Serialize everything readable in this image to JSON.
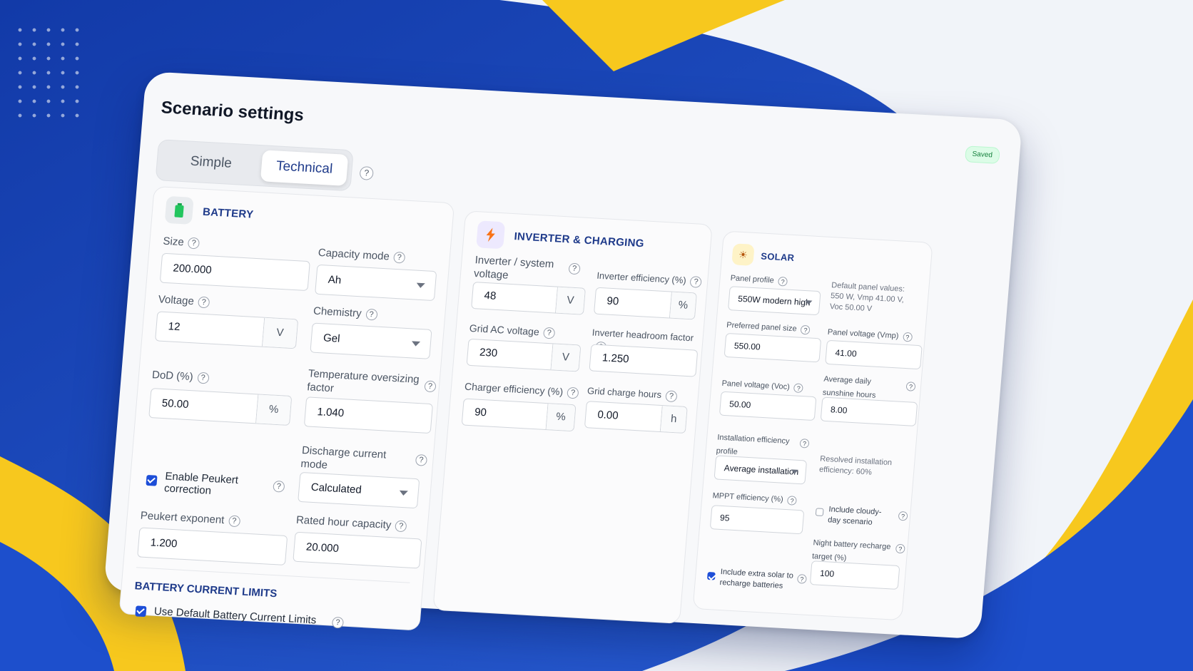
{
  "title": "Scenario settings",
  "mode_tabs": [
    "Simple",
    "Technical"
  ],
  "status_badge": "Saved",
  "battery": {
    "header": "BATTERY",
    "size_label": "Size",
    "size_value": "200.000",
    "capacity_mode_label": "Capacity mode",
    "capacity_mode_value": "Ah",
    "voltage_label": "Voltage",
    "voltage_value": "12",
    "voltage_unit": "V",
    "chemistry_label": "Chemistry",
    "chemistry_value": "Gel",
    "dod_label": "DoD (%)",
    "dod_value": "50.00",
    "dod_unit": "%",
    "temp_label": "Temperature oversizing factor",
    "temp_value": "1.040",
    "discharge_label": "Discharge current mode",
    "discharge_value": "Calculated",
    "peukert_check_label": "Enable Peukert correction",
    "peukert_exp_label": "Peukert exponent",
    "peukert_exp_value": "1.200",
    "rated_hour_label": "Rated hour capacity",
    "rated_hour_value": "20.000",
    "limits_header": "BATTERY CURRENT LIMITS",
    "limits_check_label": "Use Default Battery Current Limits"
  },
  "inverter": {
    "header": "INVERTER & CHARGING",
    "sys_voltage_label": "Inverter / system voltage",
    "sys_voltage_value": "48",
    "sys_voltage_unit": "V",
    "inv_eff_label": "Inverter efficiency (%)",
    "inv_eff_value": "90",
    "inv_eff_unit": "%",
    "grid_ac_label": "Grid AC voltage",
    "grid_ac_value": "230",
    "grid_ac_unit": "V",
    "headroom_label": "Inverter headroom factor",
    "headroom_value": "1.250",
    "charger_eff_label": "Charger efficiency (%)",
    "charger_eff_value": "90",
    "charger_eff_unit": "%",
    "grid_hours_label": "Grid charge hours",
    "grid_hours_value": "0.00",
    "grid_hours_unit": "h"
  },
  "solar": {
    "header": "SOLAR",
    "panel_profile_label": "Panel profile",
    "panel_profile_value": "550W modern high",
    "panel_defaults_note": "Default panel values: 550 W, Vmp 41.00 V, Voc 50.00 V",
    "panel_size_label": "Preferred panel size",
    "panel_size_value": "550.00",
    "vmp_label": "Panel voltage (Vmp)",
    "vmp_value": "41.00",
    "voc_label": "Panel voltage (Voc)",
    "voc_value": "50.00",
    "sunshine_label": "Average daily sunshine hours",
    "sunshine_value": "8.00",
    "install_label": "Installation efficiency profile",
    "install_value": "Average installation",
    "resolved_note": "Resolved installation efficiency: 60%",
    "mppt_label": "MPPT efficiency (%)",
    "mppt_value": "95",
    "cloudy_label": "Include cloudy-day scenario",
    "night_label": "Night battery recharge target (%)",
    "night_value": "100",
    "extra_solar_label": "Include extra solar to recharge batteries"
  },
  "colors": {
    "accent": "#1e3a8a",
    "brand_blue": "#1a47b8",
    "brand_yellow": "#f7c81e"
  }
}
